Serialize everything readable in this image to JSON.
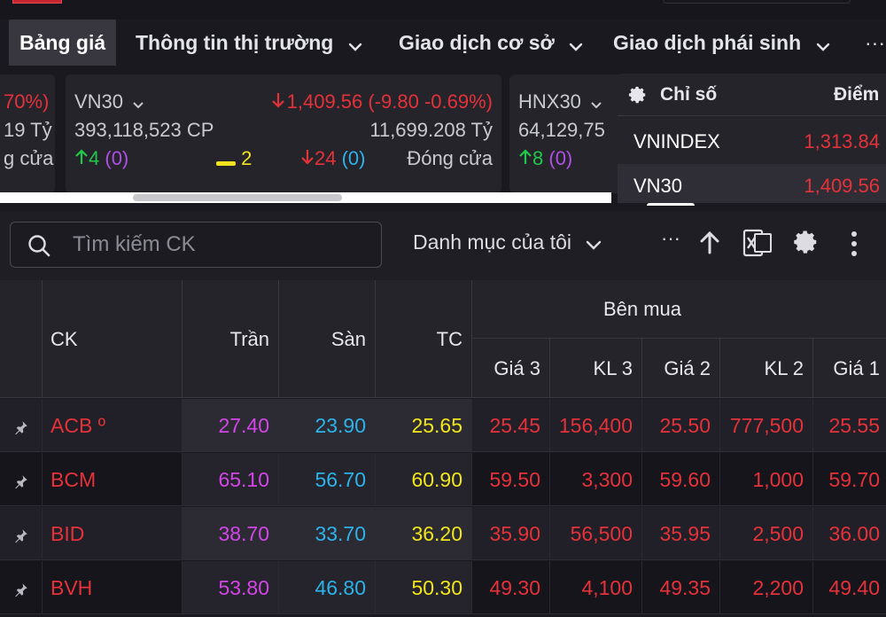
{
  "nav": {
    "items": [
      {
        "label": "Bảng giá",
        "active": true
      },
      {
        "label": "Thông tin thị trường",
        "has_dropdown": true
      },
      {
        "label": "Giao dịch cơ sở",
        "has_dropdown": true
      },
      {
        "label": "Giao dịch phái sinh",
        "has_dropdown": true
      }
    ],
    "more": "···"
  },
  "index_cards": [
    {
      "name": "",
      "change_tail": "70%)",
      "value_tail": "19 Tỷ",
      "status_tail": "g cửa"
    },
    {
      "name": "VN30",
      "change": "1,409.56 (-9.80 -0.69%)",
      "volume": "393,118,523 CP",
      "value": "11,699.208 Tỷ",
      "advances": "4",
      "advances_ce": "(0)",
      "unchanged": "2",
      "declines": "24",
      "declines_fl": "(0)",
      "status": "Đóng cửa"
    },
    {
      "name": "HNX30",
      "volume": "64,129,75",
      "advances": "8",
      "advances_ce": "(0)"
    }
  ],
  "index_table": {
    "head_label": "Chỉ số",
    "head_value": "Điểm",
    "rows": [
      {
        "name": "VNINDEX",
        "value": "1,313.84"
      },
      {
        "name": "VN30",
        "value": "1,409.56"
      }
    ]
  },
  "toolbar": {
    "search_placeholder": "Tìm kiếm CK",
    "watchlist": "Danh mục của tôi",
    "more": "···"
  },
  "grid": {
    "headers": {
      "symbol": "CK",
      "ceiling": "Trần",
      "floor": "Sàn",
      "ref": "TC",
      "bid_group": "Bên mua",
      "bid_cols": [
        "Giá 3",
        "KL 3",
        "Giá 2",
        "KL 2",
        "Giá 1"
      ]
    },
    "rows": [
      {
        "symbol": "ACB º",
        "ceiling": "27.40",
        "floor": "23.90",
        "ref": "25.65",
        "bid": [
          "25.45",
          "156,400",
          "25.50",
          "777,500",
          "25.55"
        ]
      },
      {
        "symbol": "BCM",
        "ceiling": "65.10",
        "floor": "56.70",
        "ref": "60.90",
        "bid": [
          "59.50",
          "3,300",
          "59.60",
          "1,000",
          "59.70"
        ]
      },
      {
        "symbol": "BID",
        "ceiling": "38.70",
        "floor": "33.70",
        "ref": "36.20",
        "bid": [
          "35.90",
          "56,500",
          "35.95",
          "2,500",
          "36.00"
        ]
      },
      {
        "symbol": "BVH",
        "ceiling": "53.80",
        "floor": "46.80",
        "ref": "50.30",
        "bid": [
          "49.30",
          "4,100",
          "49.35",
          "2,200",
          "49.40"
        ]
      }
    ]
  },
  "colors": {
    "up": "#20c94a",
    "down": "#e5323a",
    "ceiling": "#d445e8",
    "floor": "#2cb3ea",
    "reference": "#f1e61c",
    "background": "#1a1920"
  }
}
